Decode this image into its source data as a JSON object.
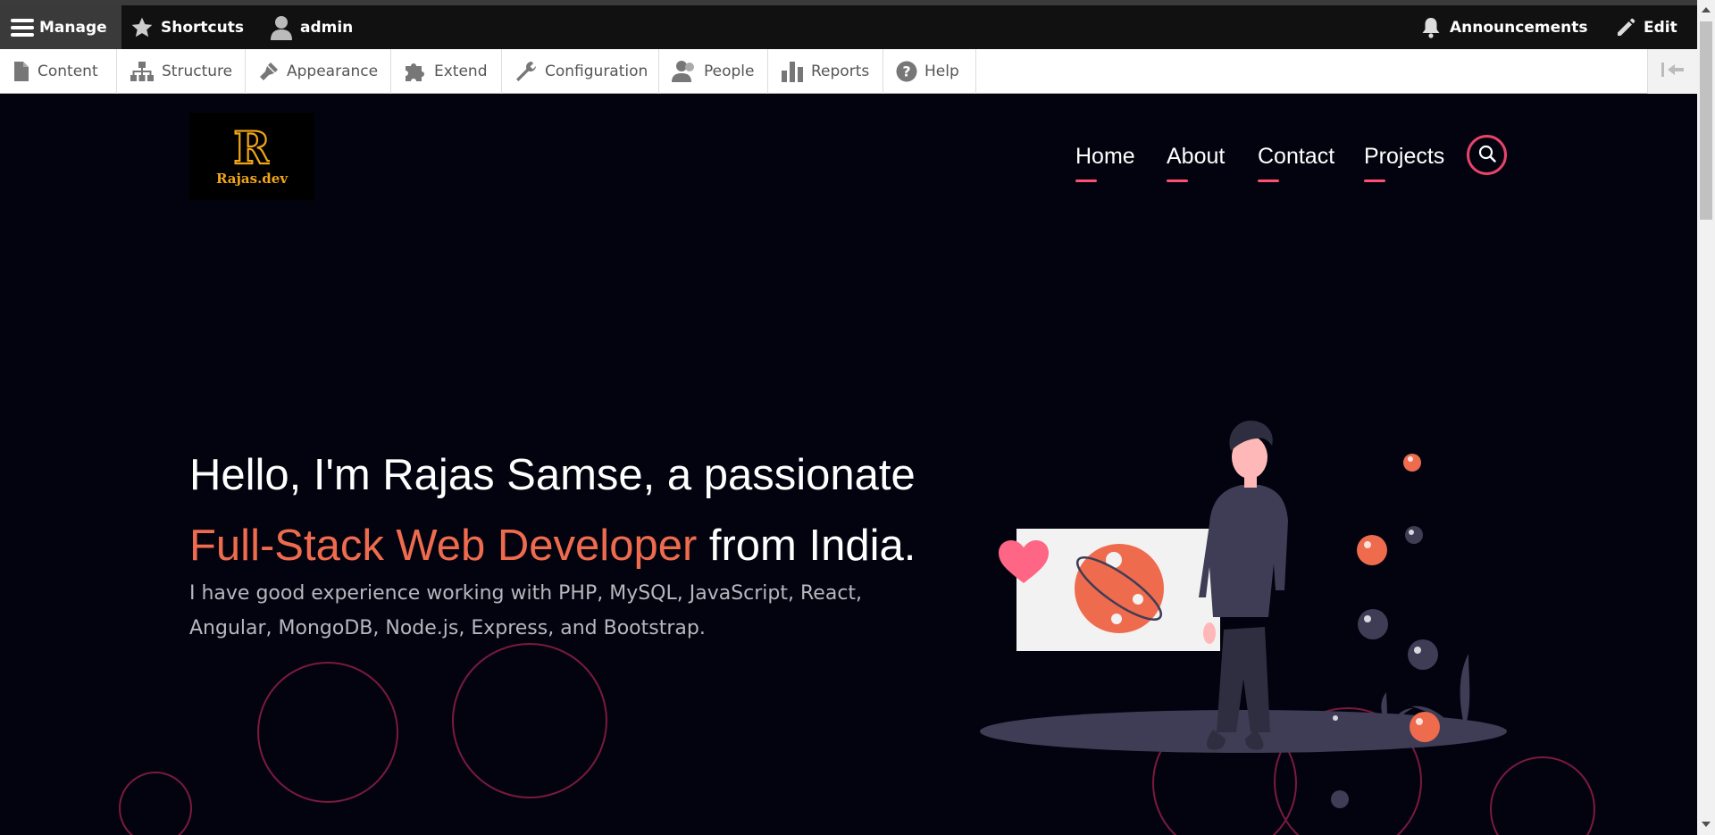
{
  "toolbar": {
    "manage_label": "Manage",
    "shortcuts_label": "Shortcuts",
    "user_label": "admin",
    "announcements_label": "Announcements",
    "edit_label": "Edit"
  },
  "tray": {
    "items": [
      {
        "label": "Content",
        "icon": "file-icon"
      },
      {
        "label": "Structure",
        "icon": "sitemap-icon"
      },
      {
        "label": "Appearance",
        "icon": "brush-icon"
      },
      {
        "label": "Extend",
        "icon": "puzzle-icon"
      },
      {
        "label": "Configuration",
        "icon": "wrench-icon"
      },
      {
        "label": "People",
        "icon": "people-icon"
      },
      {
        "label": "Reports",
        "icon": "bar-chart-icon"
      },
      {
        "label": "Help",
        "icon": "help-icon"
      }
    ]
  },
  "site": {
    "logo_text": "Rajas.dev",
    "logo_letter": "R",
    "nav": [
      "Home",
      "About",
      "Contact",
      "Projects"
    ],
    "hero": {
      "line1": "Hello, I'm Rajas Samse, a passionate",
      "accent": "Full-Stack Web Developer",
      "line2_rest": " from India.",
      "subtitle": "I have good experience working with PHP, MySQL, JavaScript, React, Angular, MongoDB, Node.js, Express, and Bootstrap."
    }
  },
  "colors": {
    "accent": "#ef6b4e",
    "nav_underline": "#ff4f72",
    "background": "#03030f",
    "logo_gold": "#f1a617"
  }
}
